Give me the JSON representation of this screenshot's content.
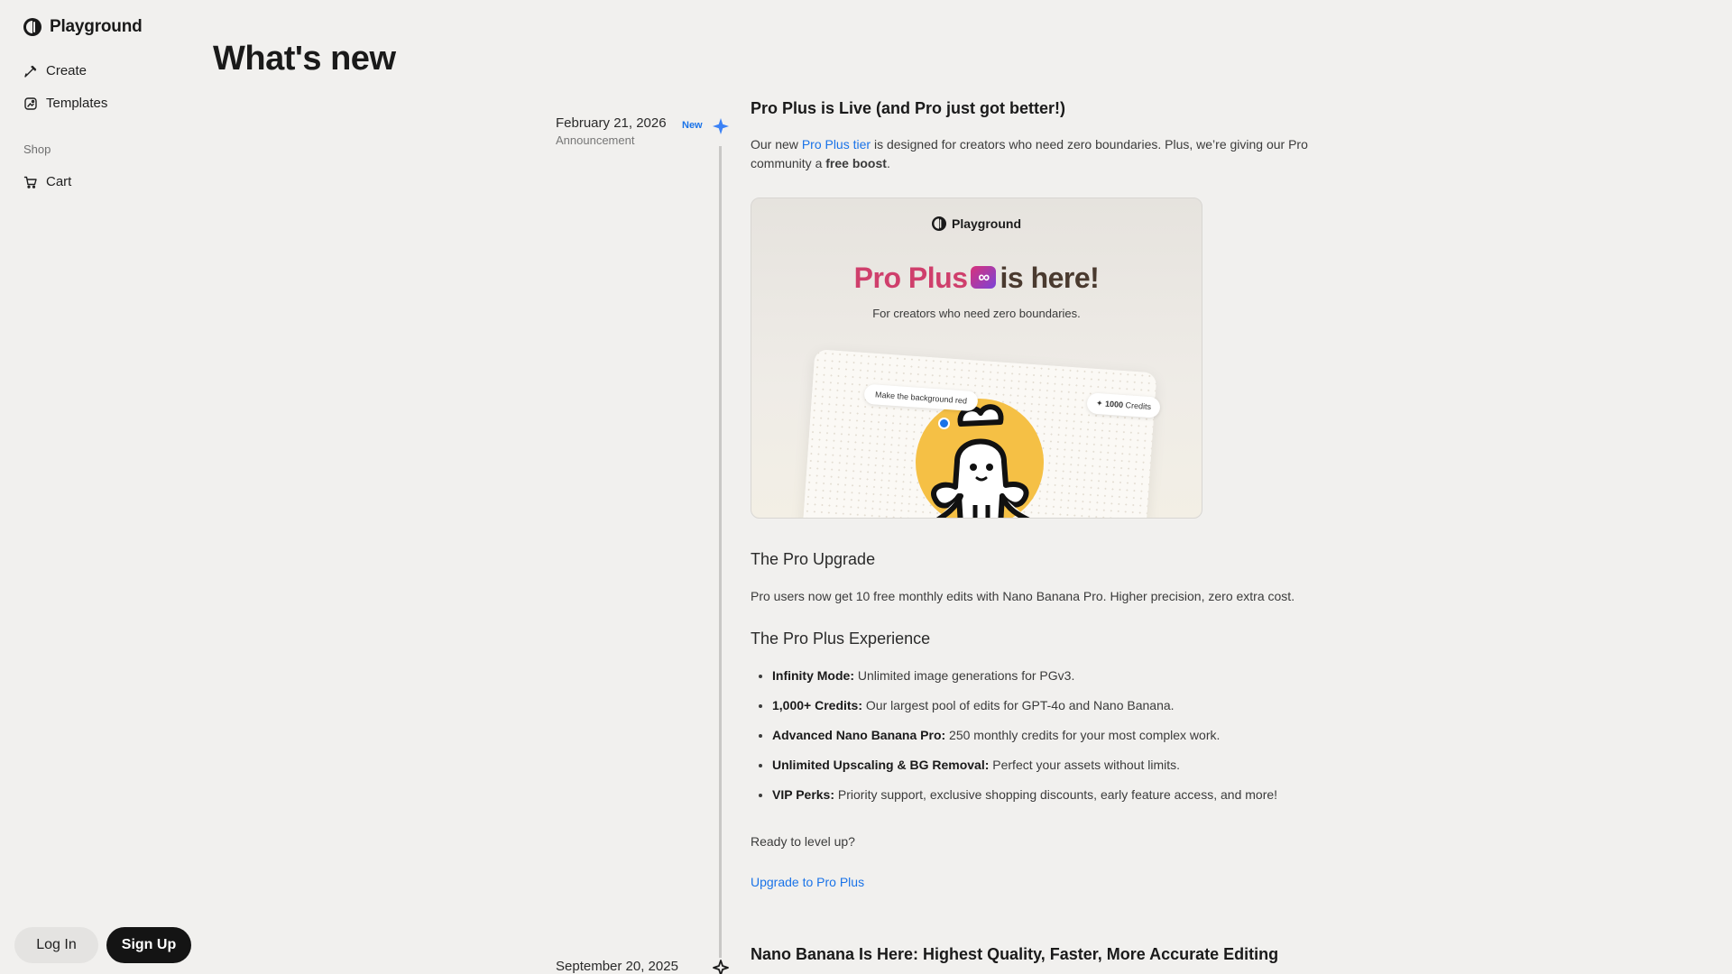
{
  "sidebar": {
    "brand": "Playground",
    "items": [
      {
        "label": "Create",
        "icon": "create-icon"
      },
      {
        "label": "Templates",
        "icon": "templates-icon"
      }
    ],
    "section_label": "Shop",
    "shop_items": [
      {
        "label": "Cart",
        "icon": "cart-icon"
      }
    ],
    "login_label": "Log In",
    "signup_label": "Sign Up"
  },
  "page": {
    "title": "What's new"
  },
  "entry1": {
    "date": "February 21, 2026",
    "type": "Announcement",
    "badge": "New",
    "title": "Pro Plus is Live (and Pro just got better!)",
    "intro_before": "Our new ",
    "intro_link": "Pro Plus tier",
    "intro_middle": " is designed for creators who need zero boundaries. Plus, we’re giving our Pro community a ",
    "intro_bold": "free boost",
    "intro_end": ".",
    "hero": {
      "brand": "Playground",
      "headline_colored": "Pro Plus",
      "headline_rest": "is here!",
      "subtitle": "For creators who need zero boundaries.",
      "prompt_chip": "Make the background red",
      "credits_number": "1000",
      "credits_label": "Credits"
    },
    "section1_title": "The Pro Upgrade",
    "section1_text": "Pro users now get 10 free monthly edits with Nano Banana Pro. Higher precision, zero extra cost.",
    "section2_title": "The Pro Plus Experience",
    "bullets": [
      {
        "bold": "Infinity Mode:",
        "text": " Unlimited image generations for PGv3."
      },
      {
        "bold": "1,000+ Credits:",
        "text": " Our largest pool of edits for GPT-4o and Nano Banana."
      },
      {
        "bold": "Advanced Nano Banana Pro:",
        "text": " 250 monthly credits for your most complex work."
      },
      {
        "bold": "Unlimited Upscaling & BG Removal:",
        "text": " Perfect your assets without limits."
      },
      {
        "bold": "VIP Perks:",
        "text": " Priority support, exclusive shopping discounts, early feature access, and more!"
      }
    ],
    "cta_text": "Ready to level up?",
    "cta_link": "Upgrade to Pro Plus"
  },
  "entry2": {
    "date": "September 20, 2025",
    "title": "Nano Banana Is Here: Highest Quality, Faster, More Accurate Editing"
  },
  "colors": {
    "accent": "#1a73e8",
    "background": "#f1f0ee",
    "signup_bg": "#141414"
  }
}
